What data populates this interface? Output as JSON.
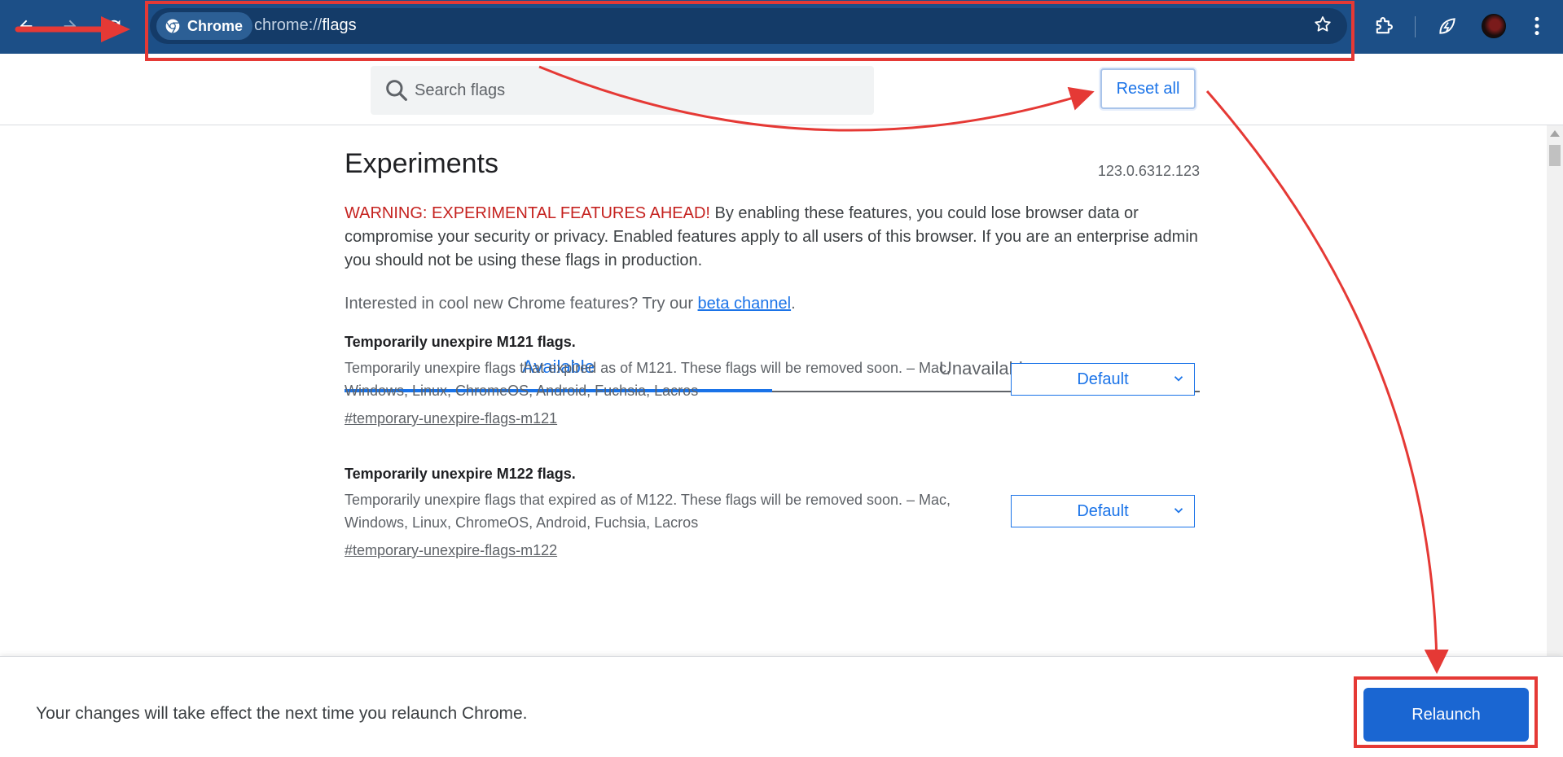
{
  "toolbar": {
    "back_icon": "back-arrow-icon",
    "forward_icon": "forward-arrow-icon",
    "reload_icon": "reload-icon",
    "chip_label": "Chrome",
    "url_scheme": "chrome://",
    "url_path": "flags",
    "bookmark_icon": "star-icon",
    "extensions_icon": "puzzle-icon",
    "performance_icon": "leaf-speed-icon",
    "menu_icon": "kebab-menu-icon"
  },
  "search": {
    "placeholder": "Search flags"
  },
  "reset_label": "Reset all",
  "page": {
    "title": "Experiments",
    "version": "123.0.6312.123",
    "warning_red": "WARNING: EXPERIMENTAL FEATURES AHEAD!",
    "warning_text": " By enabling these features, you could lose browser data or compromise your security or privacy. Enabled features apply to all users of this browser. If you are an enterprise admin you should not be using these flags in production.",
    "interest_prefix": "Interested in cool new Chrome features? Try our ",
    "interest_link": "beta channel",
    "interest_suffix": "."
  },
  "tabs": [
    {
      "label": "Available",
      "active": true
    },
    {
      "label": "Unavailable",
      "active": false
    }
  ],
  "flags": [
    {
      "title": "Temporarily unexpire M121 flags.",
      "description": "Temporarily unexpire flags that expired as of M121. These flags will be removed soon. – Mac, Windows, Linux, ChromeOS, Android, Fuchsia, Lacros",
      "anchor": "#temporary-unexpire-flags-m121",
      "value": "Default"
    },
    {
      "title": "Temporarily unexpire M122 flags.",
      "description": "Temporarily unexpire flags that expired as of M122. These flags will be removed soon. – Mac, Windows, Linux, ChromeOS, Android, Fuchsia, Lacros",
      "anchor": "#temporary-unexpire-flags-m122",
      "value": "Default"
    }
  ],
  "bottom_bar": {
    "message": "Your changes will take effect the next time you relaunch Chrome.",
    "relaunch_label": "Relaunch"
  },
  "annotations": {
    "color": "#e53935"
  }
}
